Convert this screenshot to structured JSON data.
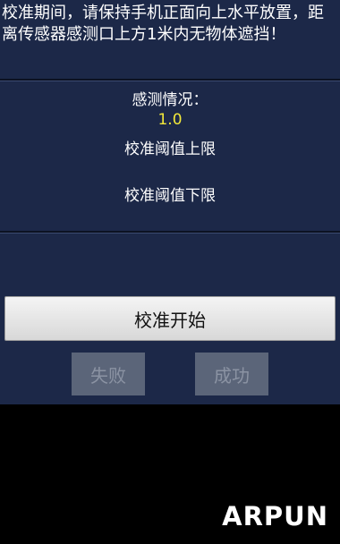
{
  "instruction": "校准期间，请保持手机正面向上水平放置，距离传感器感测口上方1米内无物体遮挡！",
  "status": {
    "title": "感测情况：",
    "value": "1.0",
    "upper_limit_label": "校准阈值上限",
    "lower_limit_label": "校准阈值下限"
  },
  "buttons": {
    "start": "校准开始",
    "fail": "失败",
    "success": "成功"
  },
  "brand": "ARPUN",
  "colors": {
    "panel_bg": "#1c2848",
    "value_color": "#f2e83a"
  }
}
